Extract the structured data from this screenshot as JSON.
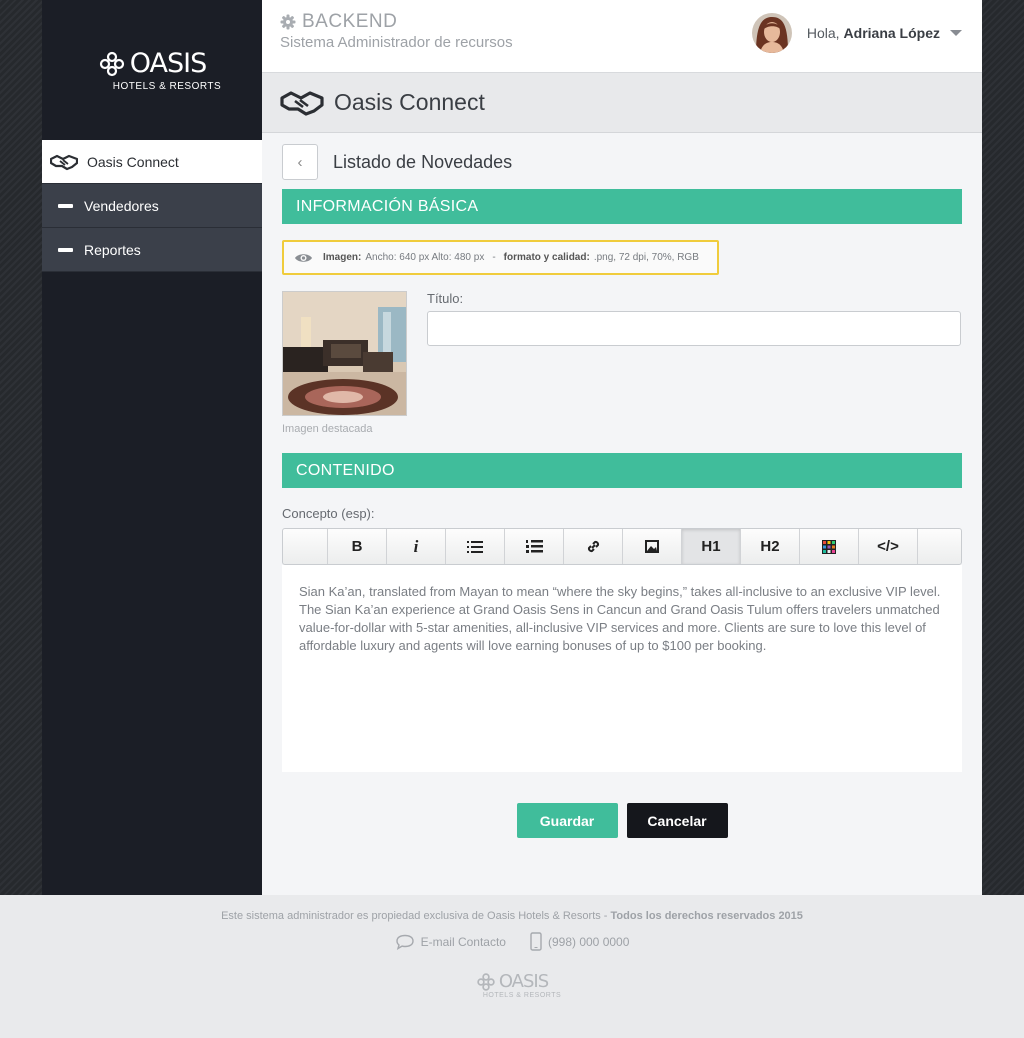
{
  "brand": {
    "logo_name": "OASIS",
    "logo_sub": "HOTELS & RESORTS",
    "app_title": "BACKEND",
    "app_subtitle": "Sistema Administrador de recursos"
  },
  "user": {
    "greeting": "Hola,",
    "name": "Adriana López"
  },
  "sidebar": {
    "items": [
      {
        "label": "Oasis Connect",
        "icon": "handshake-icon",
        "active": true
      },
      {
        "label": "Vendedores",
        "icon": "dash-icon",
        "active": false
      },
      {
        "label": "Reportes",
        "icon": "dash-icon",
        "active": false
      }
    ]
  },
  "section": {
    "title": "Oasis Connect"
  },
  "list": {
    "title": "Listado de Novedades"
  },
  "basic": {
    "heading": "INFORMACIÓN BÁSICA",
    "info_image_label": "Imagen:",
    "info_size": "Ancho: 640 px  Alto: 480 px",
    "info_sep": "-",
    "info_format_label": "formato y calidad:",
    "info_format": ".png, 72 dpi, 70%, RGB",
    "thumb_caption": "Imagen destacada",
    "title_label": "Título:",
    "title_value": ""
  },
  "content": {
    "heading": "CONTENIDO",
    "concept_label": "Concepto (esp):",
    "toolbar": [
      "B",
      "i",
      "bullet-list-icon",
      "numbered-list-icon",
      "link-icon",
      "image-icon",
      "H1",
      "H2",
      "color-grid-icon",
      "</>"
    ],
    "body": "Sian Ka’an, translated from Mayan to mean “where the sky begins,” takes all-inclusive to an exclusive VIP level. The Sian Ka’an experience at Grand Oasis Sens in Cancun and Grand Oasis Tulum offers travelers unmatched value-for-dollar with 5-star amenities, all-inclusive VIP services and more. Clients are sure to love this level of affordable luxury and agents will love earning bonuses of up to $100 per booking."
  },
  "actions": {
    "save": "Guardar",
    "cancel": "Cancelar"
  },
  "footer": {
    "text": "Este sistema administrador es propiedad exclusiva de Oasis Hotels & Resorts  -",
    "rights": "Todos los derechos reservados 2015",
    "email": "E-mail Contacto",
    "phone": "(998) 000 0000",
    "logo_name": "OASIS",
    "logo_sub": "HOTELS & RESORTS"
  },
  "colors": {
    "accent": "#40bd9b",
    "sidebar": "#1b1e26",
    "warning_border": "#f0cc3c"
  }
}
